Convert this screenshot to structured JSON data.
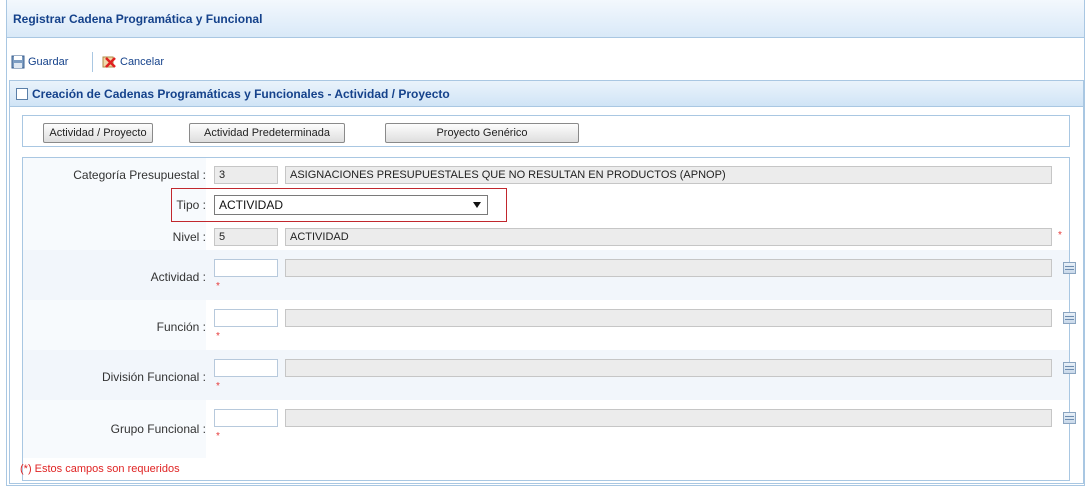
{
  "window": {
    "title": "Registrar Cadena Programática y Funcional"
  },
  "toolbar": {
    "save_label": "Guardar",
    "cancel_label": "Cancelar"
  },
  "panel": {
    "title": "Creación de Cadenas Programáticas y Funcionales - Actividad / Proyecto",
    "buttons": [
      "Actividad / Proyecto",
      "Actividad Predeterminada",
      "Proyecto Genérico"
    ]
  },
  "form": {
    "categoria": {
      "label": "Categoría Presupuestal :",
      "code": "3",
      "desc": "ASIGNACIONES PRESUPUESTALES QUE NO RESULTAN EN PRODUCTOS (APNOP)"
    },
    "tipo": {
      "label": "Tipo :",
      "value": "ACTIVIDAD"
    },
    "nivel": {
      "label": "Nivel :",
      "code": "5",
      "desc": "ACTIVIDAD"
    },
    "actividad": {
      "label": "Actividad :"
    },
    "funcion": {
      "label": "Función :"
    },
    "division": {
      "label": "División Funcional :"
    },
    "grupo": {
      "label": "Grupo Funcional :"
    },
    "required_mark": "*",
    "note": "(*) Estos campos son requeridos"
  },
  "colors": {
    "accent": "#15428b",
    "border": "#a9c7e2",
    "highlight": "#c1272d",
    "required": "#e02424",
    "stripe": "#f2f6fb"
  }
}
